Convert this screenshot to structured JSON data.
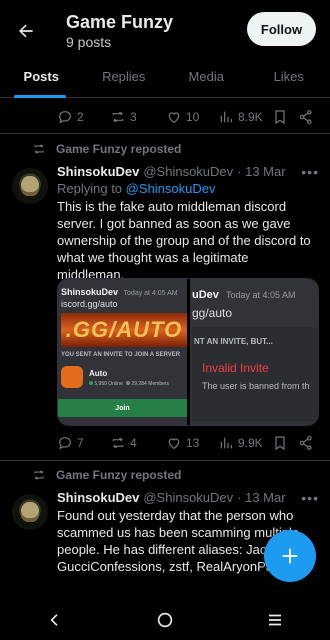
{
  "header": {
    "title": "Game Funzy",
    "posts_count": "9 posts",
    "follow_label": "Follow"
  },
  "tabs": [
    {
      "label": "Posts",
      "active": true
    },
    {
      "label": "Replies",
      "active": false
    },
    {
      "label": "Media",
      "active": false
    },
    {
      "label": "Likes",
      "active": false
    }
  ],
  "post0": {
    "replies": "2",
    "reposts": "3",
    "likes": "10",
    "views": "8.9K"
  },
  "post1": {
    "repost_label": "Game Funzy reposted",
    "display_name": "ShinsokuDev",
    "handle": "@ShinsokuDev",
    "date": "· 13 Mar",
    "replying_prefix": "Replying to ",
    "replying_mention": "@ShinsokuDev",
    "text": "This is the fake auto middleman discord server. I got banned as soon as we gave ownership of the group and of the discord to what we thought was a legitimate middleman.",
    "media_left": {
      "name": "ShinsokuDev",
      "time": "Today at 4:05 AM",
      "url": "iscord.gg/auto",
      "banner": ".GG/AUTO",
      "invite_header": "YOU SENT AN INVITE TO JOIN A SERVER",
      "server_name": "Auto",
      "online": "5,950 Online",
      "members": "29,284 Members",
      "join_label": "Join"
    },
    "media_right": {
      "name": "uDev",
      "time": "Today at 4:05 AM",
      "url": "gg/auto",
      "invite_header": "NT AN INVITE, BUT...",
      "invalid_title": "Invalid Invite",
      "invalid_desc": "The user is banned from th"
    },
    "replies": "7",
    "reposts": "4",
    "likes": "13",
    "views": "9.9K"
  },
  "post2": {
    "repost_label": "Game Funzy reposted",
    "display_name": "ShinsokuDev",
    "handle": "@ShinsokuDev",
    "date": "· 13 Mar",
    "text": "Found out yesterday that the person who scammed us has been scamming multiple people. He has different aliases: Jaco GucciConfessions, zstf, RealAryonPa"
  },
  "icons": {
    "back": "arrow-left-icon",
    "reply": "reply-icon",
    "repost": "repost-icon",
    "like": "heart-icon",
    "views": "views-icon",
    "bookmark": "bookmark-icon",
    "share": "share-icon",
    "more": "more-icon",
    "compose": "plus-icon"
  },
  "colors": {
    "accent": "#1d9bf0",
    "muted": "#71767b",
    "text": "#e7e9ea",
    "background": "#000000",
    "discord_join": "#248046",
    "invalid": "#f23f43"
  }
}
